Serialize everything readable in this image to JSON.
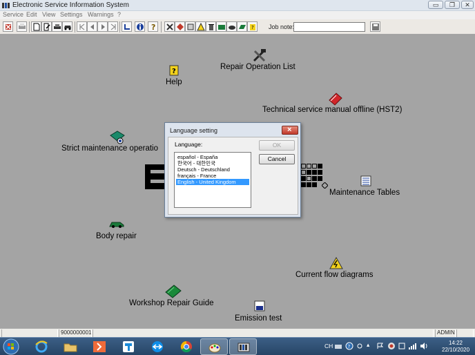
{
  "window": {
    "title": "Electronic Service Information System",
    "controls": {
      "minimize": "▭",
      "maximize": "❐",
      "close": "✕"
    }
  },
  "menu": [
    "Service",
    "Edit",
    "View",
    "Settings",
    "Warnings",
    "?"
  ],
  "toolbar": {
    "job_note_label": "Job note:",
    "job_note_value": "",
    "icons": [
      "exit-icon",
      "print-icon",
      "new-document-icon",
      "edit-document-icon",
      "vehicle-icon",
      "car-icon",
      "first-page-icon",
      "previous-page-icon",
      "next-page-icon",
      "last-page-icon",
      "back-arrow-icon",
      "info-icon",
      "question-icon",
      "tools-icon",
      "stop-icon",
      "page-icon",
      "warning-icon",
      "trash-icon",
      "book-icon",
      "car-repair-icon",
      "folder-icon",
      "help-book-icon",
      "save-icon"
    ]
  },
  "workspace": {
    "items": {
      "repair_operation_list": "Repair Operation List",
      "help": "Help",
      "technical_service_manual": "Technical service manual offline (HST2)",
      "strict_maintenance": "Strict maintenance operatio",
      "maintenance_tables": "Maintenance Tables",
      "body_repair": "Body repair",
      "current_flow_diagrams": "Current flow diagrams",
      "workshop_repair_guide": "Workshop Repair Guide",
      "emission_test": "Emission test"
    }
  },
  "dialog": {
    "title": "Language setting",
    "label": "Language:",
    "languages": [
      "español - España",
      "한국어 - 대한민국",
      "Deutsch - Deutschland",
      "français - France",
      "English - United Kingdom"
    ],
    "selected_index": 4,
    "ok_label": "OK",
    "cancel_label": "Cancel"
  },
  "statusbar": {
    "field1": "",
    "field2": "9000000001",
    "user": "ADMIN"
  },
  "taskbar": {
    "tray_lang": "CH",
    "time": "14:22",
    "date": "22/10/2020"
  },
  "colors": {
    "workspace_bg": "#a4a4a4",
    "selection": "#3399ff",
    "taskbar": "#2f5076"
  }
}
